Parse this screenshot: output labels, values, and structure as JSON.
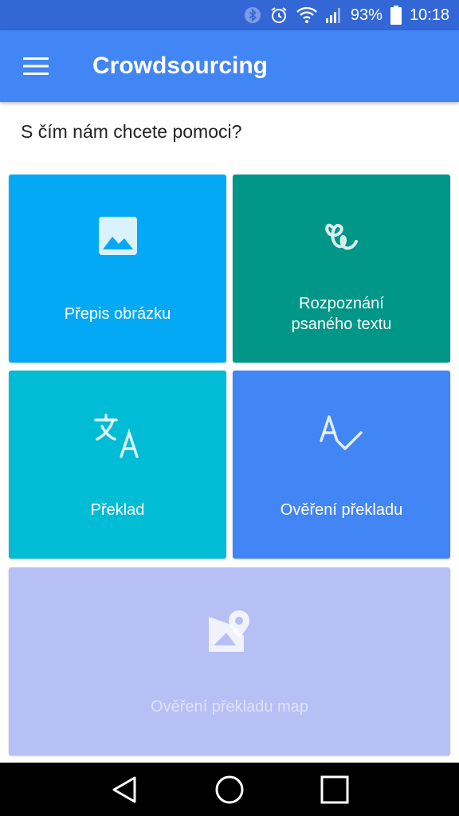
{
  "status": {
    "battery_percent": "93%",
    "time": "10:18",
    "icons": [
      "bluetooth-icon",
      "alarm-icon",
      "wifi-icon",
      "signal-icon",
      "battery-icon"
    ]
  },
  "app_bar": {
    "title": "Crowdsourcing",
    "menu_icon": "hamburger-menu-icon",
    "color": "#4285f4",
    "status_color": "#3367d6"
  },
  "prompt": "S čím nám chcete pomoci?",
  "tiles": [
    {
      "label": "Přepis obrázku",
      "icon": "image-icon",
      "color": "#03a9f4",
      "enabled": true
    },
    {
      "label": "Rozpoznání psaného textu",
      "icon": "handwriting-icon",
      "color": "#009688",
      "enabled": true
    },
    {
      "label": "Překlad",
      "icon": "translate-icon",
      "color": "#00bcd4",
      "enabled": true
    },
    {
      "label": "Ověření překladu",
      "icon": "spellcheck-icon",
      "color": "#4285f4",
      "enabled": true
    },
    {
      "label": "Ověření překladu map",
      "icon": "map-marker-icon",
      "color": "#b6c0f4",
      "enabled": false
    }
  ],
  "nav": {
    "icons": [
      "back-icon",
      "home-icon",
      "recents-icon"
    ]
  }
}
